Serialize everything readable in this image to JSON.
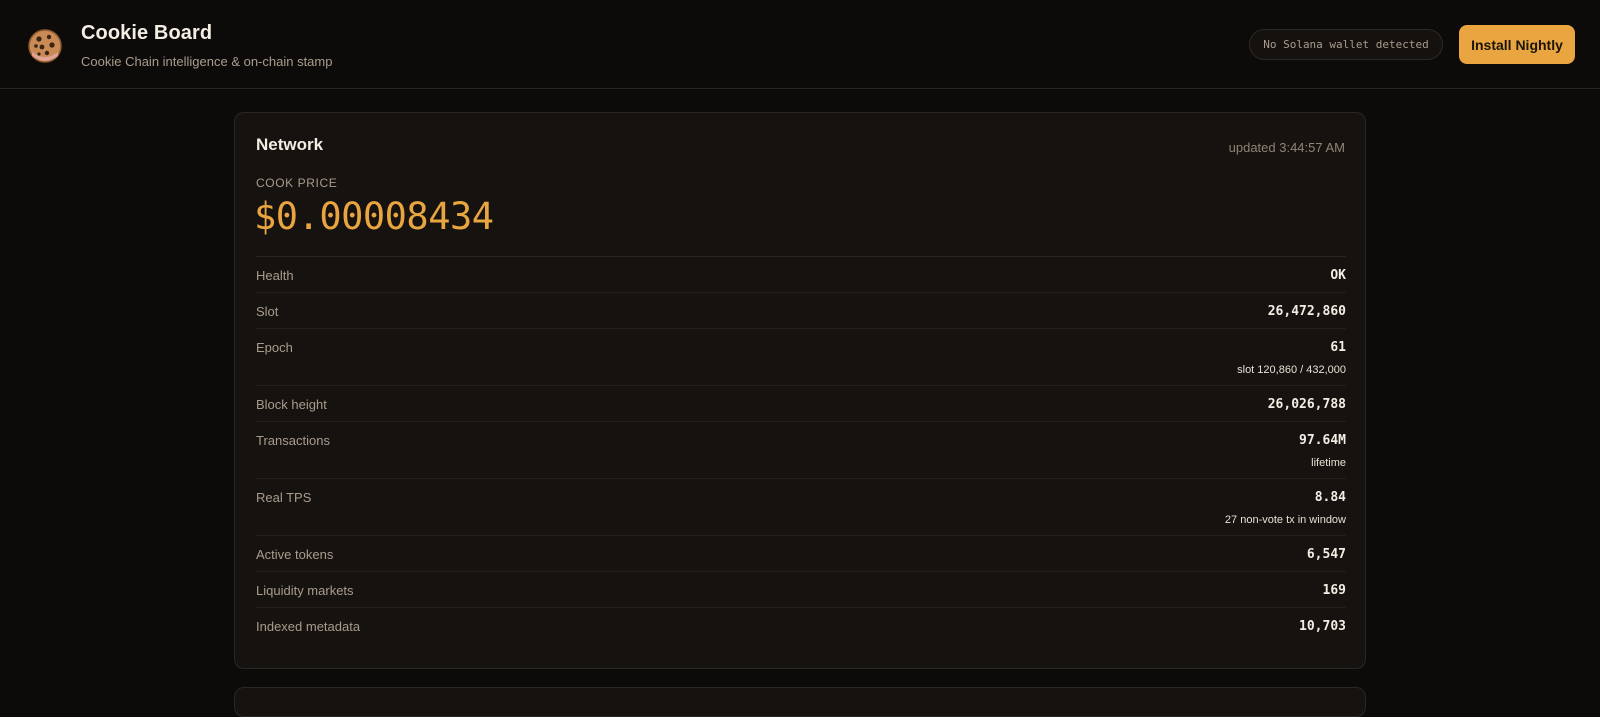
{
  "header": {
    "title": "Cookie Board",
    "subtitle": "Cookie Chain intelligence & on-chain stamp",
    "logo_icon": "cookie-icon",
    "wallet_status": "No Solana wallet detected",
    "install_label": "Install Nightly"
  },
  "colors": {
    "accent": "#e9a53f",
    "background": "#0d0b09",
    "card": "#16120f"
  },
  "network": {
    "title": "Network",
    "updated": "updated 3:44:57 AM",
    "price_label": "COOK PRICE",
    "price_value": "$0.00008434",
    "stats": [
      {
        "label": "Health",
        "value": "OK"
      },
      {
        "label": "Slot",
        "value": "26,472,860"
      },
      {
        "label": "Epoch",
        "value": "61",
        "sub": "slot 120,860 / 432,000"
      },
      {
        "label": "Block height",
        "value": "26,026,788"
      },
      {
        "label": "Transactions",
        "value": "97.64M",
        "sub": "lifetime"
      },
      {
        "label": "Real TPS",
        "value": "8.84",
        "sub": "27 non-vote tx in window"
      },
      {
        "label": "Active tokens",
        "value": "6,547"
      },
      {
        "label": "Liquidity markets",
        "value": "169"
      },
      {
        "label": "Indexed metadata",
        "value": "10,703"
      }
    ]
  }
}
